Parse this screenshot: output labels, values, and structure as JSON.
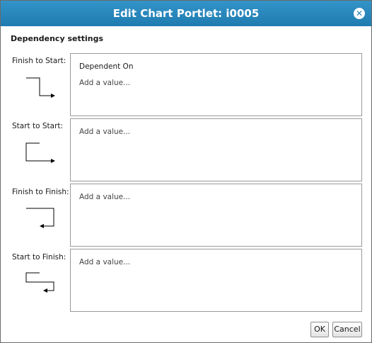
{
  "dialog": {
    "title": "Edit Chart Portlet: i0005",
    "close_icon": "close-icon"
  },
  "section_title": "Dependency settings",
  "dependencies": [
    {
      "label": "Finish to Start:",
      "tag": "Dependent On",
      "placeholder": "Add a value...",
      "icon": "finish-to-start-icon"
    },
    {
      "label": "Start to Start:",
      "placeholder": "Add a value...",
      "icon": "start-to-start-icon"
    },
    {
      "label": "Finish to Finish:",
      "placeholder": "Add a value...",
      "icon": "finish-to-finish-icon"
    },
    {
      "label": "Start to Finish:",
      "placeholder": "Add a value...",
      "icon": "start-to-finish-icon"
    }
  ],
  "buttons": {
    "ok": "OK",
    "cancel": "Cancel"
  },
  "colors": {
    "title_bar": "#2a86bb",
    "title_text": "#ffffff",
    "border": "#9a9a9a"
  }
}
